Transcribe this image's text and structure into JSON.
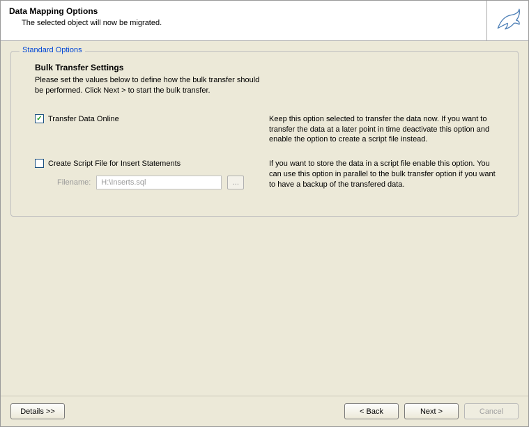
{
  "header": {
    "title": "Data Mapping Options",
    "subtitle": "The selected object will now be migrated."
  },
  "fieldset": {
    "legend": "Standard Options",
    "section_title": "Bulk Transfer Settings",
    "section_desc": "Please set the values below to define how the bulk transfer should be performed. Click Next > to start the bulk transfer."
  },
  "opt1": {
    "label": "Transfer Data Online",
    "checked": true,
    "desc": "Keep this option selected to transfer the data now. If you want to transfer the data at a later point in time deactivate this option and enable the option to create a script file instead."
  },
  "opt2": {
    "label": "Create Script File for Insert Statements",
    "checked": false,
    "desc": "If you want to store the data in a script file enable this option. You can use this option in parallel to the bulk transfer option if you want to have a backup of the transfered data.",
    "filename_label": "Filename:",
    "filename_value": "H:\\Inserts.sql",
    "browse_label": "..."
  },
  "footer": {
    "details": "Details >>",
    "back": "< Back",
    "next": "Next >",
    "cancel": "Cancel"
  }
}
